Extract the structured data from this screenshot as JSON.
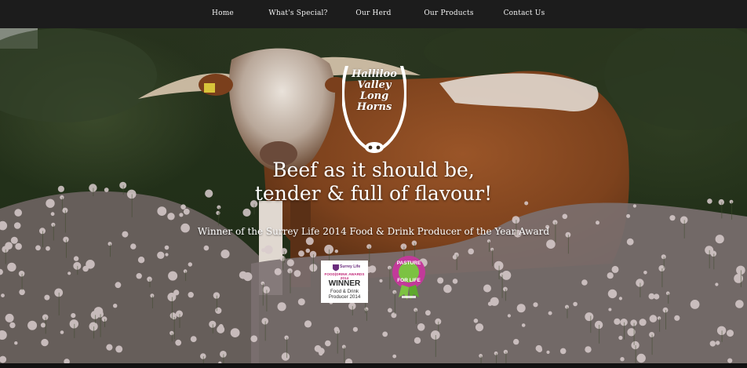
{
  "nav": {
    "items": [
      {
        "label": "Home"
      },
      {
        "label": "What's Special?"
      },
      {
        "label": "Our Herd"
      },
      {
        "label": "Our Products"
      },
      {
        "label": "Contact Us"
      }
    ]
  },
  "logo": {
    "text": "Halliloo\nValley\nLong\nHorns"
  },
  "hero": {
    "headline_line1": "Beef as it should be,",
    "headline_line2": "tender & full of flavour!",
    "award_text": "Winner of the Surrey Life 2014 Food & Drink Producer of the Year Award"
  },
  "badges": {
    "surrey": {
      "brand": "Surrey Life",
      "awards": "FOOD|DRINK AWARDS 2014",
      "title": "WINNER",
      "subtitle": "Food & Drink\nProducer 2014"
    },
    "pasture": {
      "line1": "PASTURE",
      "line2": "FOR LIFE"
    }
  },
  "colors": {
    "nav_bg": "#1c1c1c",
    "nav_text": "#f2f2f2",
    "hero_text": "#ffffff",
    "cow_coat": "#8a4a22",
    "pasture_badge": "#c23a9a",
    "pasture_ribbon": "#7cc242"
  }
}
